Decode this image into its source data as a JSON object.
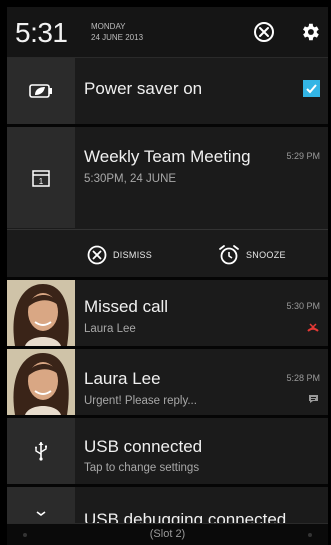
{
  "status": {
    "time": "5:31",
    "weekday": "MONDAY",
    "date": "24 JUNE 2013",
    "icons": [
      "clear-all-icon",
      "settings-gear-icon"
    ]
  },
  "notifications": [
    {
      "id": "power",
      "icon": "battery-leaf-icon",
      "title": "Power saver on",
      "checked": true,
      "accent": "#33b5e5"
    },
    {
      "id": "meeting",
      "icon": "calendar-icon",
      "calendar_day": "1",
      "title": "Weekly Team Meeting",
      "subtitle": "5:30PM, 24 JUNE",
      "time": "5:29 PM",
      "actions": [
        {
          "icon": "dismiss-icon",
          "label": "DISMISS"
        },
        {
          "icon": "alarm-clock-icon",
          "label": "SNOOZE"
        }
      ]
    },
    {
      "id": "missed",
      "title": "Missed call",
      "subtitle": "Laura Lee",
      "time": "5:30 PM",
      "badge_icon": "missed-call-icon",
      "badge_color": "#e53935"
    },
    {
      "id": "message",
      "title": "Laura Lee",
      "subtitle": "Urgent! Please reply...",
      "time": "5:28 PM",
      "badge_icon": "message-bubble-icon"
    },
    {
      "id": "usb",
      "icon": "usb-icon",
      "title": "USB connected",
      "subtitle": "Tap to change settings"
    },
    {
      "id": "usbdebug",
      "icon": "bug-icon",
      "title": "USB debugging connected"
    }
  ],
  "navbar": {
    "slot_label": "(Slot 2)"
  }
}
